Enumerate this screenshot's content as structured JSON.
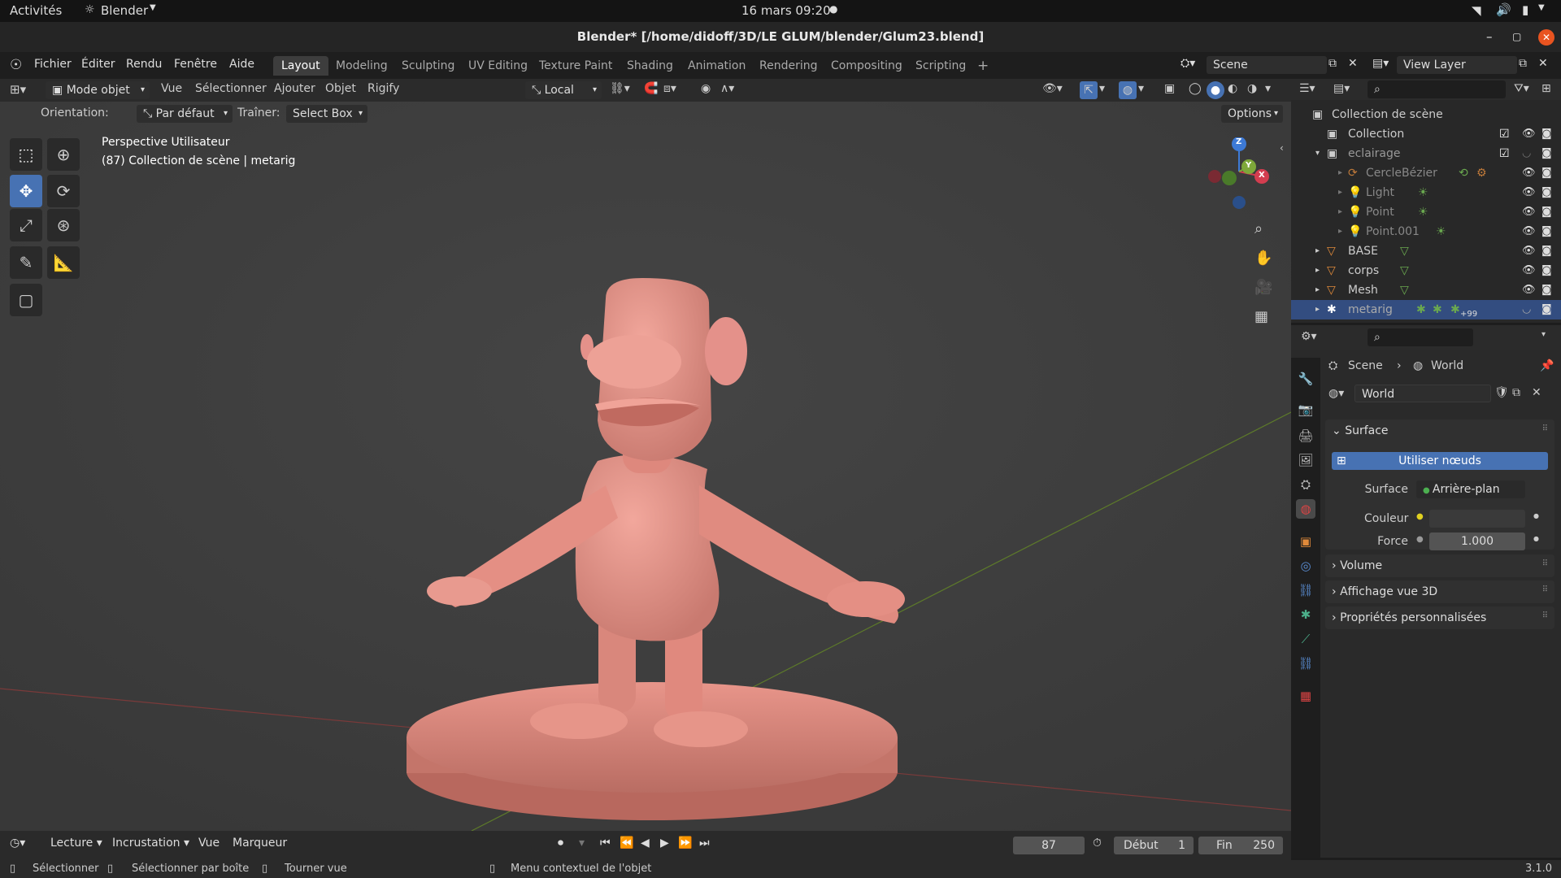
{
  "system_bar": {
    "activities": "Activités",
    "app_name": "Blender",
    "datetime": "16 mars  09:20"
  },
  "window": {
    "title": "Blender* [/home/didoff/3D/LE GLUM/blender/Glum23.blend]"
  },
  "menu": {
    "items": [
      "Fichier",
      "Éditer",
      "Rendu",
      "Fenêtre",
      "Aide"
    ]
  },
  "workspaces": {
    "tabs": [
      "Layout",
      "Modeling",
      "Sculpting",
      "UV Editing",
      "Texture Paint",
      "Shading",
      "Animation",
      "Rendering",
      "Compositing",
      "Scripting"
    ],
    "active": "Layout",
    "add": "+"
  },
  "scene_selector": {
    "scene": "Scene",
    "view_layer": "View Layer"
  },
  "viewport_header": {
    "mode": "Mode objet",
    "menus": [
      "Vue",
      "Sélectionner",
      "Ajouter",
      "Objet",
      "Rigify"
    ],
    "transform_space": "Local"
  },
  "tool_settings": {
    "orientation_label": "Orientation:",
    "orientation_value": "Par défaut",
    "drag_label": "Traîner:",
    "drag_value": "Select Box",
    "options": "Options"
  },
  "viewport": {
    "view_name": "Perspective Utilisateur",
    "context": "(87) Collection de scène | metarig",
    "gizmo_axes": {
      "z": "Z",
      "x": "X",
      "y": "Y"
    }
  },
  "outliner": {
    "root": "Collection de scène",
    "rows": [
      {
        "label": "Collection"
      },
      {
        "label": "eclairage"
      },
      {
        "label": "CercleBézier"
      },
      {
        "label": "Light"
      },
      {
        "label": "Point"
      },
      {
        "label": "Point.001"
      },
      {
        "label": "BASE"
      },
      {
        "label": "corps"
      },
      {
        "label": "Mesh"
      },
      {
        "label": "metarig",
        "badge": "+99"
      }
    ]
  },
  "properties": {
    "breadcrumb_scene": "Scene",
    "breadcrumb_world": "World",
    "world_name": "World",
    "panels": {
      "surface": "Surface",
      "use_nodes": "Utiliser nœuds",
      "surface_label": "Surface",
      "surface_value": "Arrière-plan",
      "color_label": "Couleur",
      "strength_label": "Force",
      "strength_value": "1.000",
      "volume": "Volume",
      "viewport_display": "Affichage vue 3D",
      "custom_props": "Propriétés personnalisées"
    }
  },
  "timeline": {
    "menus": [
      "Lecture",
      "Incrustation",
      "Vue",
      "Marqueur"
    ],
    "current_frame": "87",
    "start_label": "Début",
    "start_value": "1",
    "end_label": "Fin",
    "end_value": "250"
  },
  "statusbar": {
    "select": "Sélectionner",
    "box_select": "Sélectionner par boîte",
    "rotate": "Tourner vue",
    "context_menu": "Menu contextuel de l'objet",
    "version": "3.1.0"
  },
  "colors": {
    "accent": "#4772b3",
    "model": "#e8958a",
    "viewport_bg": "#3b3b3b"
  }
}
